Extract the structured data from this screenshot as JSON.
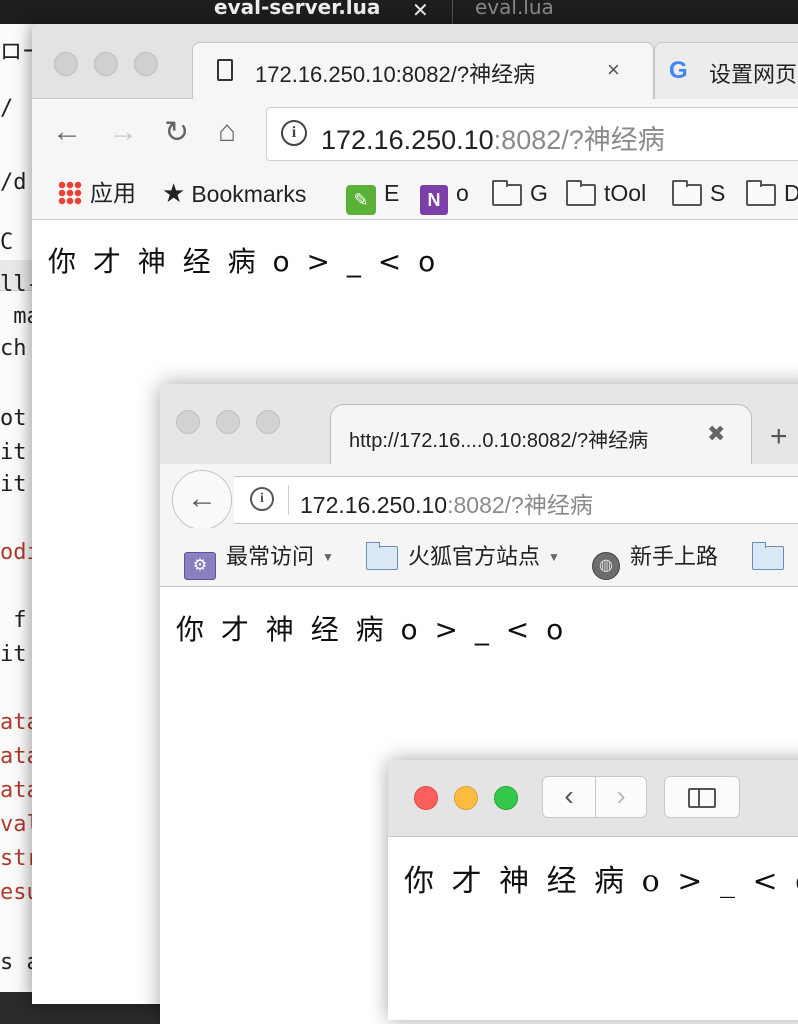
{
  "editor": {
    "tabs": [
      {
        "label": "eval-server.lua",
        "active": true
      },
      {
        "label": "eval.lua",
        "active": false
      }
    ],
    "close_glyph": "✕",
    "code_fragments": [
      {
        "text": "ロー",
        "red": false
      },
      {
        "text": "/",
        "red": false
      },
      {
        "text": "/d",
        "red": false
      },
      {
        "text": "C",
        "red": false
      },
      {
        "text": "ll-",
        "red": false
      },
      {
        "text": " ma",
        "red": false
      },
      {
        "text": "ch",
        "red": false
      },
      {
        "text": "ot",
        "red": false
      },
      {
        "text": "it",
        "red": false
      },
      {
        "text": "it",
        "red": false
      },
      {
        "text": "odi",
        "red": true
      },
      {
        "text": " f",
        "red": false
      },
      {
        "text": "it",
        "red": false
      },
      {
        "text": "ata",
        "red": true
      },
      {
        "text": "ata",
        "red": true
      },
      {
        "text": "ata",
        "red": true
      },
      {
        "text": "val",
        "red": true
      },
      {
        "text": "str",
        "red": true
      },
      {
        "text": "esu",
        "red": true
      },
      {
        "text": "s a",
        "red": false
      }
    ]
  },
  "chrome": {
    "tab_active_title": "172.16.250.10:8082/?神经病",
    "tab_close": "×",
    "tab2_title": "设置网页",
    "nav": {
      "back": "←",
      "forward": "→",
      "reload": "↻",
      "home": "⌂"
    },
    "address": {
      "host": "172.16.250.10",
      "rest": ":8082/?神经病"
    },
    "bookmarks": [
      {
        "label": "应用",
        "icon": "apps-grid-icon"
      },
      {
        "label": "Bookmarks",
        "icon": "star-icon"
      },
      {
        "label": "E",
        "icon": "evernote-icon"
      },
      {
        "label": "o",
        "icon": "onenote-icon"
      },
      {
        "label": "G",
        "icon": "folder-icon"
      },
      {
        "label": "tOol",
        "icon": "folder-icon"
      },
      {
        "label": "S",
        "icon": "folder-icon"
      },
      {
        "label": "D",
        "icon": "folder-icon"
      }
    ],
    "content": "你 才 神 经 病 o > _ < o"
  },
  "firefox": {
    "tab_title": "http://172.16....0.10:8082/?神经病",
    "tab_close": "✖",
    "new_tab": "+",
    "back": "←",
    "address": {
      "host": "172.16.250.10",
      "rest": ":8082/?神经病"
    },
    "bookmarks": [
      {
        "label": "最常访问",
        "icon": "most-visited-icon",
        "dropdown": true
      },
      {
        "label": "火狐官方站点",
        "icon": "folder-icon",
        "dropdown": true
      },
      {
        "label": "新手上路",
        "icon": "globe-icon",
        "dropdown": false
      }
    ],
    "content": "你 才 神 经 病 o > _ < o"
  },
  "safari": {
    "back": "‹",
    "forward": "›",
    "content": "你 才 神 经 病 o > _ < o"
  },
  "colors": {
    "close": "#fc605c",
    "minimize": "#fdbc40",
    "zoom": "#34c84a"
  }
}
